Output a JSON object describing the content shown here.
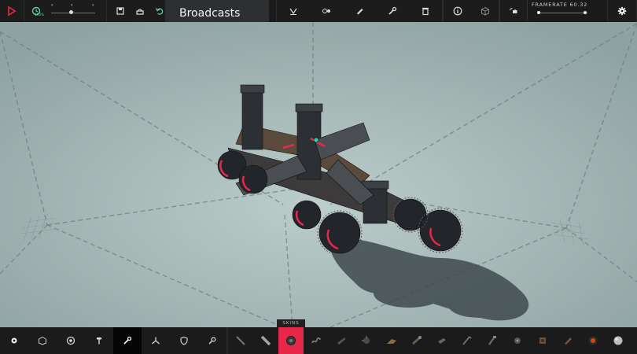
{
  "top_bar": {
    "broadcast_label": "Broadcasts",
    "sim_speed_label": "100%",
    "framerate_label": "FRAMERATE",
    "framerate_value": "60.32",
    "time_slider_value": 0.45,
    "framerate_slider_value": 0.95,
    "icons": [
      "play-icon",
      "clock-icon",
      "save-icon",
      "load-icon",
      "undo-icon",
      "mirror-icon",
      "center-icon",
      "paint-icon",
      "wrench-icon",
      "trash-icon",
      "info-icon",
      "cube-icon",
      "camera-icon",
      "settings-icon"
    ]
  },
  "bottom_bar": {
    "skins_label": "SKINS",
    "tools": [
      "gear-tool-icon",
      "cube-tool-icon",
      "target-tool-icon",
      "hammer-tool-icon",
      "wrench-tool-icon",
      "axes-tool-icon",
      "shield-tool-icon",
      "key-tool-icon"
    ],
    "active_tool_index": 4,
    "selected_block_index": 2,
    "blocks": [
      "rod-block",
      "piston-block",
      "wheel-block",
      "spring-block",
      "cannon-block",
      "grabber-block",
      "crossbow-block",
      "bomb-block",
      "drill-block",
      "saw-block",
      "flamethrower-block",
      "pin-block",
      "winch-block",
      "boulder-block",
      "ball-block",
      "sphere-block",
      "orb-block"
    ]
  },
  "colors": {
    "accent": "#e8284b",
    "bar": "#1b1b1b",
    "background": "#a8bab8"
  }
}
